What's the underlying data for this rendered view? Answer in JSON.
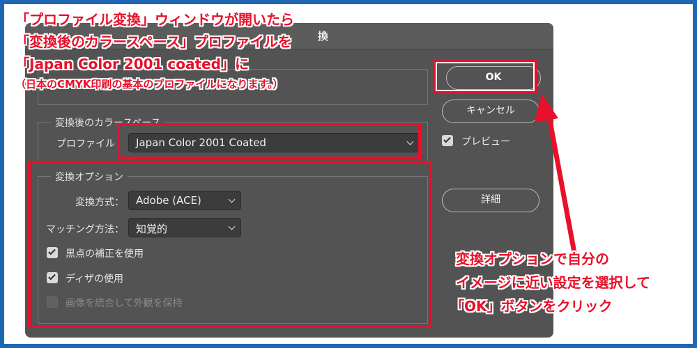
{
  "dialog": {
    "title_fragment": "換",
    "source_profile_text": "",
    "dest_group_title": "変換後のカラースペース",
    "profile_label": "プロファイル",
    "profile_value": "Japan Color 2001 Coated",
    "options_group_title": "変換オプション",
    "engine_label": "変換方式：",
    "engine_value": "Adobe (ACE)",
    "intent_label": "マッチング方法：",
    "intent_value": "知覚的",
    "blackpoint_label": "黒点の補正を使用",
    "blackpoint_checked": true,
    "dither_label": "ディザの使用",
    "dither_checked": true,
    "flatten_label": "画像を統合して外観を保持",
    "flatten_checked": false,
    "flatten_enabled": false,
    "ok_label": "OK",
    "cancel_label": "キャンセル",
    "preview_label": "プレビュー",
    "preview_checked": true,
    "advanced_label": "詳細"
  },
  "annotations": {
    "top_line1": "「プロファイル変換」ウィンドウが開いたら",
    "top_line2": "「変換後のカラースペース」プロファイルを",
    "top_line3": "「Japan Color 2001 coated」に",
    "top_line4": "（日本のCMYK印刷の基本のプロファイルになります。）",
    "bottom_line1": "変換オプションで自分の",
    "bottom_line2": "イメージに近い設定を選択して",
    "bottom_line3": "「OK」ボタンをクリック"
  },
  "colors": {
    "frame": "#1f67b5",
    "annotation_red": "#e8102a",
    "dialog_bg": "#535353"
  }
}
